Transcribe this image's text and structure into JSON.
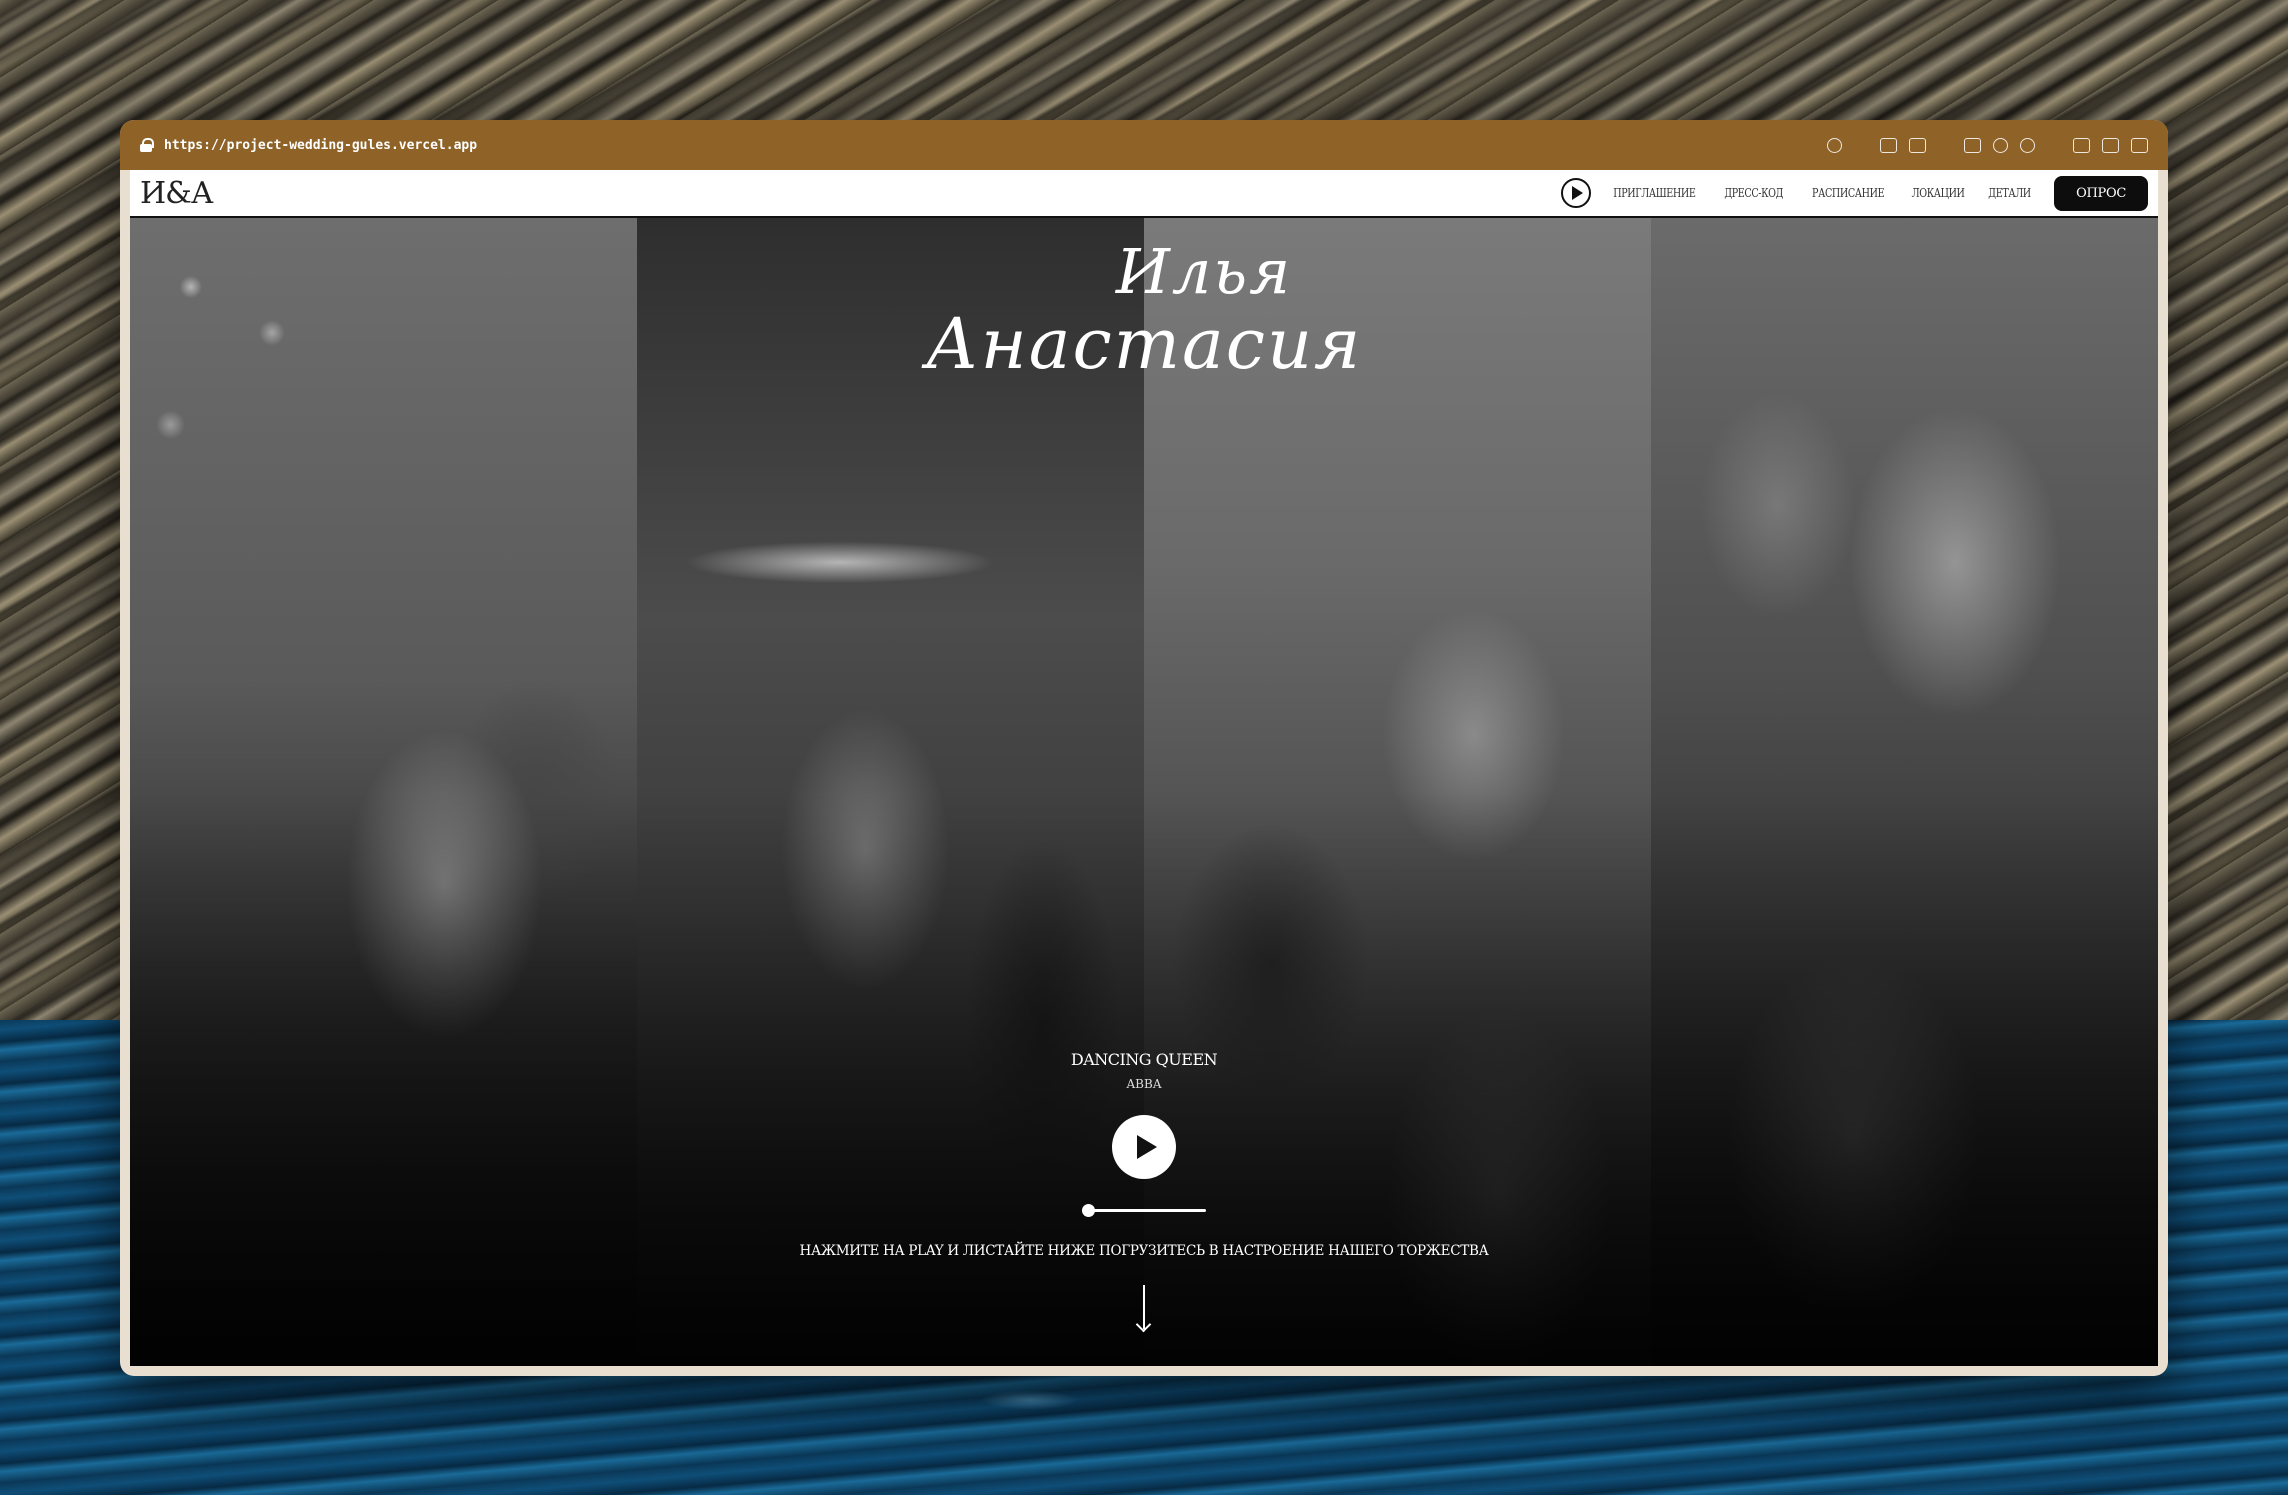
{
  "browser": {
    "url": "https://project-wedding-gules.vercel.app",
    "toolbar_icons": [
      "link-icon",
      "screenshot-icon",
      "camera-icon",
      "mail-icon",
      "globe-icon",
      "crosshair-icon",
      "code-icon",
      "picture-in-picture-icon",
      "split-view-icon"
    ]
  },
  "site": {
    "logo": "И&А",
    "nav": {
      "items": [
        "ПРИГЛАШЕНИЕ",
        "ДРЕСС-КОД",
        "РАСПИСАНИЕ",
        "ЛОКАЦИИ",
        "ДЕТАЛИ"
      ],
      "cta": "ОПРОС"
    }
  },
  "hero": {
    "name_1": "Илья",
    "name_2": "Анастасия",
    "song": {
      "title": "DANCING QUEEN",
      "artist": "ABBA",
      "progress": 0.0
    },
    "hint": "НАЖМИТЕ НА PLAY И ЛИСТАЙТЕ НИЖЕ ПОГРУЗИТЕСЬ В НАСТРОЕНИЕ НАШЕГО ТОРЖЕСТВА"
  },
  "colors": {
    "titlebar": "#8f6328",
    "navbar_bg": "#ffffff",
    "cta_bg": "#0d0d0d"
  }
}
